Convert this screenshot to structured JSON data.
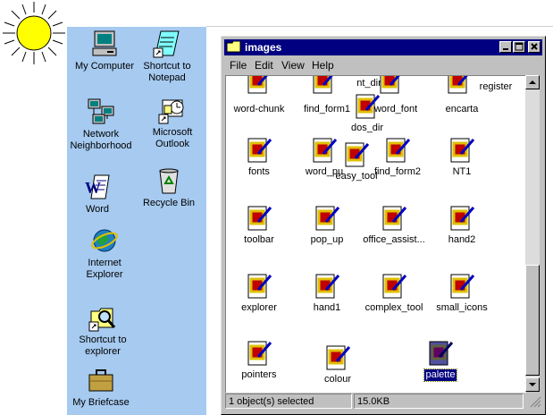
{
  "desktop": {
    "icons": [
      {
        "label": "My Computer",
        "icon": "my-computer-icon"
      },
      {
        "label": "Shortcut to Notepad",
        "icon": "notepad-shortcut-icon"
      },
      {
        "label": "Network Neighborhood",
        "icon": "network-neighborhood-icon"
      },
      {
        "label": "Microsoft Outlook",
        "icon": "outlook-icon"
      },
      {
        "label": "Word",
        "icon": "word-icon"
      },
      {
        "label": "Recycle Bin",
        "icon": "recycle-bin-icon"
      },
      {
        "label": "Internet Explorer",
        "icon": "internet-explorer-icon"
      },
      {
        "label": "Shortcut to explorer",
        "icon": "explorer-shortcut-icon"
      },
      {
        "label": "My Briefcase",
        "icon": "briefcase-icon"
      }
    ],
    "background": "#a6caf0"
  },
  "window": {
    "title": "images",
    "menu": {
      "file": "File",
      "edit": "Edit",
      "view": "View",
      "help": "Help"
    },
    "files": [
      {
        "name": "nt_dir"
      },
      {
        "name": "register"
      },
      {
        "name": "word-chunk"
      },
      {
        "name": "find_form1"
      },
      {
        "name": "word_font"
      },
      {
        "name": "encarta"
      },
      {
        "name": "dos_dir"
      },
      {
        "name": "fonts"
      },
      {
        "name": "word_pu"
      },
      {
        "name": "easy_tool"
      },
      {
        "name": "find_form2"
      },
      {
        "name": "NT1"
      },
      {
        "name": "toolbar"
      },
      {
        "name": "pop_up"
      },
      {
        "name": "office_assist..."
      },
      {
        "name": "hand2"
      },
      {
        "name": "explorer"
      },
      {
        "name": "hand1"
      },
      {
        "name": "complex_tool"
      },
      {
        "name": "small_icons"
      },
      {
        "name": "pointers"
      },
      {
        "name": "colour"
      },
      {
        "name": "palette"
      }
    ],
    "selected_file": "palette",
    "status": {
      "objects": "1 object(s) selected",
      "size": "15.0KB"
    }
  },
  "colors": {
    "titlebar": "#000080",
    "chrome": "#c0c0c0",
    "selection": "#000080"
  }
}
